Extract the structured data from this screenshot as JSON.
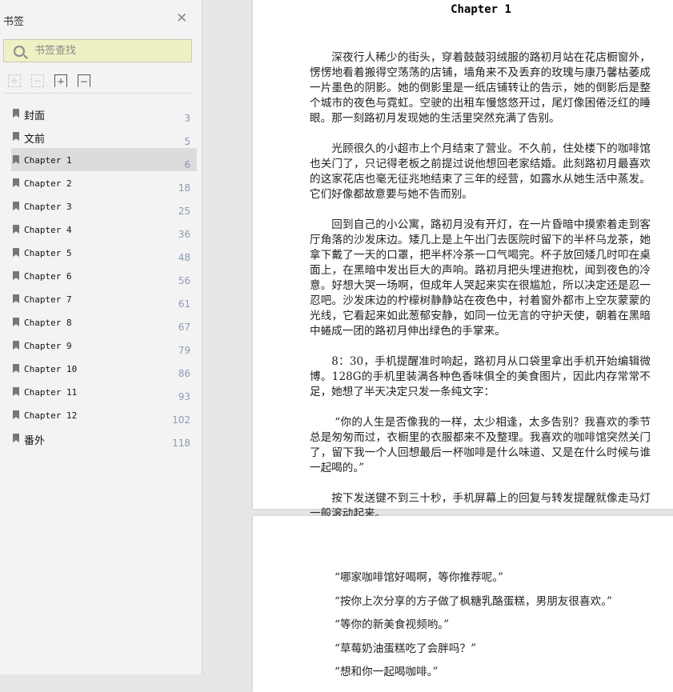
{
  "sidebar": {
    "title": "书签",
    "close_icon": "close-icon",
    "search_placeholder": "书签查找",
    "tools": [
      "expand-all-icon",
      "collapse-all-icon",
      "add-bookmark-icon",
      "remove-bookmark-icon"
    ],
    "items": [
      {
        "label": "封面",
        "page": "3"
      },
      {
        "label": "文前",
        "page": "5"
      },
      {
        "label": "Chapter 1",
        "page": "6",
        "selected": true
      },
      {
        "label": "Chapter 2",
        "page": "18"
      },
      {
        "label": "Chapter 3",
        "page": "25"
      },
      {
        "label": "Chapter 4",
        "page": "36"
      },
      {
        "label": "Chapter 5",
        "page": "48"
      },
      {
        "label": "Chapter 6",
        "page": "56"
      },
      {
        "label": "Chapter 7",
        "page": "61"
      },
      {
        "label": "Chapter 8",
        "page": "67"
      },
      {
        "label": "Chapter 9",
        "page": "79"
      },
      {
        "label": "Chapter 10",
        "page": "86"
      },
      {
        "label": "Chapter 11",
        "page": "93"
      },
      {
        "label": "Chapter 12",
        "page": "102"
      },
      {
        "label": "番外",
        "page": "118"
      }
    ]
  },
  "page1": {
    "title": "Chapter 1",
    "paragraphs": [
      "深夜行人稀少的街头，穿着鼓鼓羽绒服的路初月站在花店橱窗外，愣愣地看着搬得空荡荡的店铺，墙角来不及丢弃的玫瑰与康乃馨枯萎成一片墨色的阴影。她的倒影里是一纸店铺转让的告示，她的倒影后是整个城市的夜色与霓虹。空驶的出租车慢悠悠开过，尾灯像困倦泛红的睡眼。那一刻路初月发现她的生活里突然充满了告别。",
      "光顾很久的小超市上个月结束了营业。不久前，住处楼下的咖啡馆也关门了，只记得老板之前提过说他想回老家结婚。此刻路初月最喜欢的这家花店也毫无征兆地结束了三年的经营，如露水从她生活中蒸发。它们好像都故意要与她不告而别。",
      "回到自己的小公寓，路初月没有开灯，在一片昏暗中摸索着走到客厅角落的沙发床边。矮几上是上午出门去医院时留下的半杯乌龙茶，她拿下戴了一天的口罩，把半杯冷茶一口气喝完。杯子放回矮几时叩在桌面上，在黑暗中发出巨大的声响。路初月把头埋进抱枕，闻到夜色的冷意。好想大哭一场啊，但成年人哭起来实在很尴尬，所以决定还是忍一忍吧。沙发床边的柠檬树静静站在夜色中，衬着窗外都市上空灰蒙蒙的光线，它看起来如此葱郁安静，如同一位无言的守护天使，朝着在黑暗中蜷成一团的路初月伸出绿色的手掌来。",
      "8：30，手机提醒准时响起，路初月从口袋里拿出手机开始编辑微博。128G的手机里装满各种色香味俱全的美食图片，因此内存常常不足，她想了半天决定只发一条纯文字：",
      "“你的人生是否像我的一样，太少相逢，太多告别？我喜欢的季节总是匆匆而过，衣橱里的衣服都来不及整理。我喜欢的咖啡馆突然关门了，留下我一个人回想最后一杯咖啡是什么味道、又是在什么时候与谁一起喝的。”",
      "按下发送键不到三十秒，手机屏幕上的回复与转发提醒就像走马灯一般滚动起来。"
    ]
  },
  "page2": {
    "lines": [
      "“哪家咖啡馆好喝啊，等你推荐呢。”",
      "“按你上次分享的方子做了枫糖乳酪蛋糕，男朋友很喜欢。”",
      "“等你的新美食视频哟。”",
      "“草莓奶油蛋糕吃了会胖吗？”",
      "“想和你一起喝咖啡。”"
    ]
  }
}
